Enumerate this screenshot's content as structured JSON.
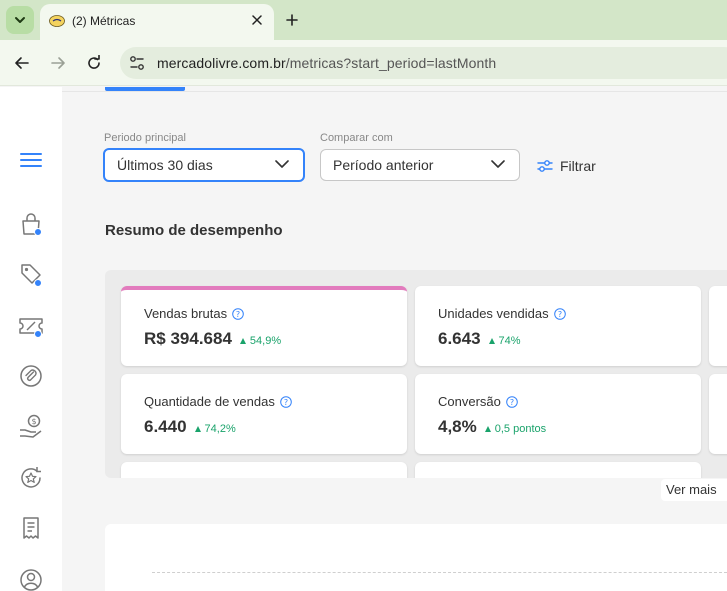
{
  "browser": {
    "tab_title": "(2) Métricas",
    "url_host": "mercadolivre.com.br",
    "url_path": "/metricas?start_period=lastMonth"
  },
  "sidebar": {
    "items": [
      {
        "icon": "menu-icon"
      },
      {
        "icon": "shopping-bag-icon",
        "badge": true
      },
      {
        "icon": "tag-icon",
        "badge": true
      },
      {
        "icon": "ticket-icon",
        "badge": true
      },
      {
        "icon": "clip-icon"
      },
      {
        "icon": "money-hand-icon"
      },
      {
        "icon": "star-refresh-icon"
      },
      {
        "icon": "receipt-icon"
      },
      {
        "icon": "user-icon"
      }
    ]
  },
  "filters": {
    "primary_label": "Periodo principal",
    "primary_value": "Últimos 30 dias",
    "compare_label": "Comparar com",
    "compare_value": "Período anterior",
    "filter_button": "Filtrar"
  },
  "summary": {
    "title": "Resumo de desempenho",
    "cards": [
      {
        "label": "Vendas brutas",
        "value": "R$ 394.684",
        "delta": "54,9%"
      },
      {
        "label": "Unidades vendidas",
        "value": "6.643",
        "delta": "74%"
      },
      {
        "label": "Quantidade de vendas",
        "value": "6.440",
        "delta": "74,2%"
      },
      {
        "label": "Conversão",
        "value": "4,8%",
        "delta": "0,5 pontos"
      }
    ],
    "see_more": "Ver mais"
  },
  "colors": {
    "accent": "#3483fa",
    "highlight": "#e27bbd",
    "positive": "#1aa36b"
  }
}
